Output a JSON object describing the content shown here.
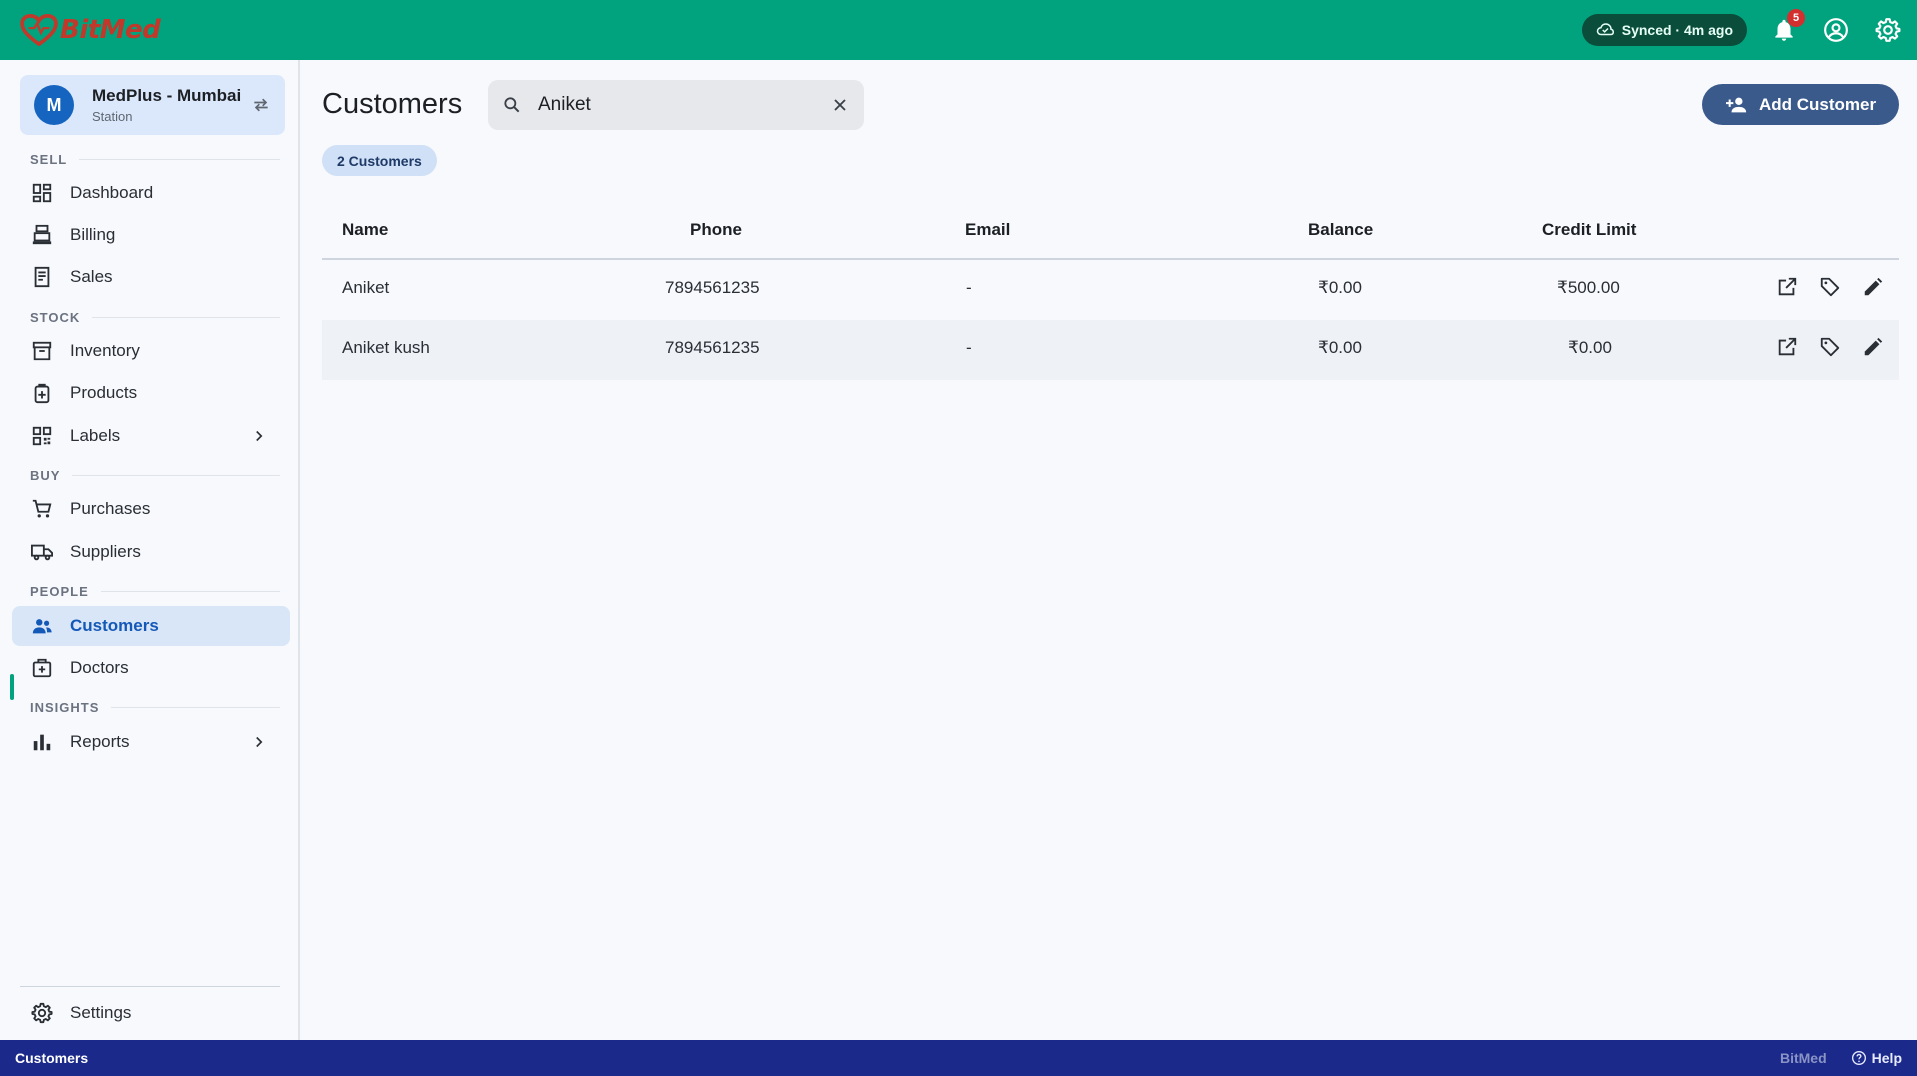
{
  "app": {
    "brand": "BitMed",
    "sync_status": "Synced · 4m ago",
    "notifications_count": "5"
  },
  "station": {
    "initial": "M",
    "name": "MedPlus - Mumbai",
    "subtitle": "Station"
  },
  "sidebar": {
    "sections": [
      {
        "label": "SELL",
        "items": [
          {
            "label": "Dashboard",
            "icon": "dashboard-icon"
          },
          {
            "label": "Billing",
            "icon": "billing-icon"
          },
          {
            "label": "Sales",
            "icon": "sales-icon"
          }
        ]
      },
      {
        "label": "STOCK",
        "items": [
          {
            "label": "Inventory",
            "icon": "inventory-icon"
          },
          {
            "label": "Products",
            "icon": "products-icon"
          },
          {
            "label": "Labels",
            "icon": "qr-code-icon"
          }
        ]
      },
      {
        "label": "BUY",
        "items": [
          {
            "label": "Purchases",
            "icon": "cart-icon"
          },
          {
            "label": "Suppliers",
            "icon": "truck-icon"
          }
        ]
      },
      {
        "label": "PEOPLE",
        "items": [
          {
            "label": "Customers",
            "icon": "people-icon"
          },
          {
            "label": "Doctors",
            "icon": "medical-bag-icon"
          }
        ]
      },
      {
        "label": "INSIGHTS",
        "items": [
          {
            "label": "Reports",
            "icon": "bar-chart-icon"
          }
        ]
      }
    ],
    "settings_label": "Settings"
  },
  "main": {
    "title": "Customers",
    "search_value": "Aniket",
    "add_button_label": "Add Customer",
    "count_label": "2 Customers",
    "columns": [
      "Name",
      "Phone",
      "Email",
      "Balance",
      "Credit Limit"
    ],
    "rows": [
      {
        "name": "Aniket",
        "phone": "7894561235",
        "email": "-",
        "balance": "₹0.00",
        "credit_limit": "₹500.00"
      },
      {
        "name": "Aniket kush",
        "phone": "7894561235",
        "email": "-",
        "balance": "₹0.00",
        "credit_limit": "₹0.00"
      }
    ]
  },
  "footer": {
    "page": "Customers",
    "brand": "BitMed",
    "help": "Help"
  },
  "colors": {
    "topbar": "#00a37d",
    "accent": "#1559b8",
    "primary_button": "#3b5a8c",
    "footer": "#1b2a8a",
    "badge": "#d32f2f"
  }
}
